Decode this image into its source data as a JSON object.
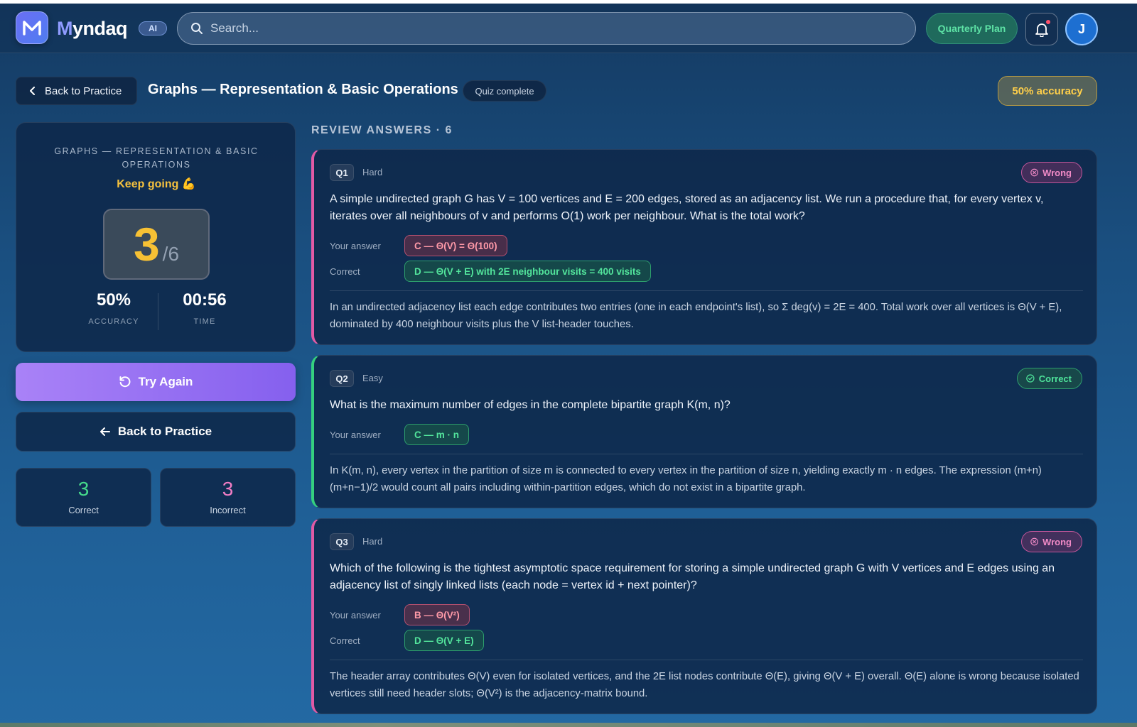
{
  "brand": {
    "name_rest": "yndaq",
    "name_first": "M",
    "badge": "AI"
  },
  "search": {
    "placeholder": "Search..."
  },
  "header": {
    "plan_label": "Quarterly Plan",
    "avatar_initial": "J"
  },
  "subheader": {
    "back_label": "Back to Practice",
    "title": "Graphs — Representation & Basic Operations",
    "status": "Quiz complete",
    "accuracy_badge": "50% accuracy"
  },
  "score": {
    "topic": "Graphs — Representation & Basic Operations",
    "motivation": "Keep going 💪",
    "correct": "3",
    "total": "/6",
    "accuracy_value": "50%",
    "accuracy_label": "ACCURACY",
    "time_value": "00:56",
    "time_label": "TIME"
  },
  "actions": {
    "try_again": "Try Again",
    "back_to_practice": "Back to Practice"
  },
  "counts": {
    "correct_value": "3",
    "correct_label": "Correct",
    "incorrect_value": "3",
    "incorrect_label": "Incorrect"
  },
  "review": {
    "title": "REVIEW ANSWERS · 6",
    "your_answer_label": "Your answer",
    "correct_label": "Correct",
    "questions": [
      {
        "num": "Q1",
        "difficulty": "Hard",
        "verdict": "Wrong",
        "text": "A simple undirected graph G has V = 100 vertices and E = 200 edges, stored as an adjacency list. We run a procedure that, for every vertex v, iterates over all neighbours of v and performs O(1) work per neighbour. What is the total work?",
        "your_answer": "C — Θ(V) = Θ(100)",
        "correct_answer": "D — Θ(V + E) with 2E neighbour visits = 400 visits",
        "explanation": "In an undirected adjacency list each edge contributes two entries (one in each endpoint's list), so Σ deg(v) = 2E = 400. Total work over all vertices is Θ(V + E), dominated by 400 neighbour visits plus the V list-header touches."
      },
      {
        "num": "Q2",
        "difficulty": "Easy",
        "verdict": "Correct",
        "text": "What is the maximum number of edges in the complete bipartite graph K(m, n)?",
        "your_answer": "C — m · n",
        "explanation": "In K(m, n), every vertex in the partition of size m is connected to every vertex in the partition of size n, yielding exactly m · n edges. The expression (m+n)(m+n−1)/2 would count all pairs including within-partition edges, which do not exist in a bipartite graph."
      },
      {
        "num": "Q3",
        "difficulty": "Hard",
        "verdict": "Wrong",
        "text": "Which of the following is the tightest asymptotic space requirement for storing a simple undirected graph G with V vertices and E edges using an adjacency list of singly linked lists (each node = vertex id + next pointer)?",
        "your_answer": "B — Θ(V²)",
        "correct_answer": "D — Θ(V + E)",
        "explanation": "The header array contributes Θ(V) even for isolated vertices, and the 2E list nodes contribute Θ(E), giving Θ(V + E) overall. Θ(E) alone is wrong because isolated vertices still need header slots; Θ(V²) is the adjacency-matrix bound."
      }
    ]
  },
  "colors": {
    "accent_purple": "#8560ee",
    "correct_green": "#35d07f",
    "wrong_pink": "#e25aa5",
    "score_gold": "#f7c134",
    "plan_green": "#5ee3a6"
  },
  "icons": [
    "logo-icon",
    "search-icon",
    "bell-icon",
    "chevron-left-icon",
    "refresh-icon",
    "arrow-left-icon",
    "x-circle-icon",
    "check-circle-icon"
  ]
}
